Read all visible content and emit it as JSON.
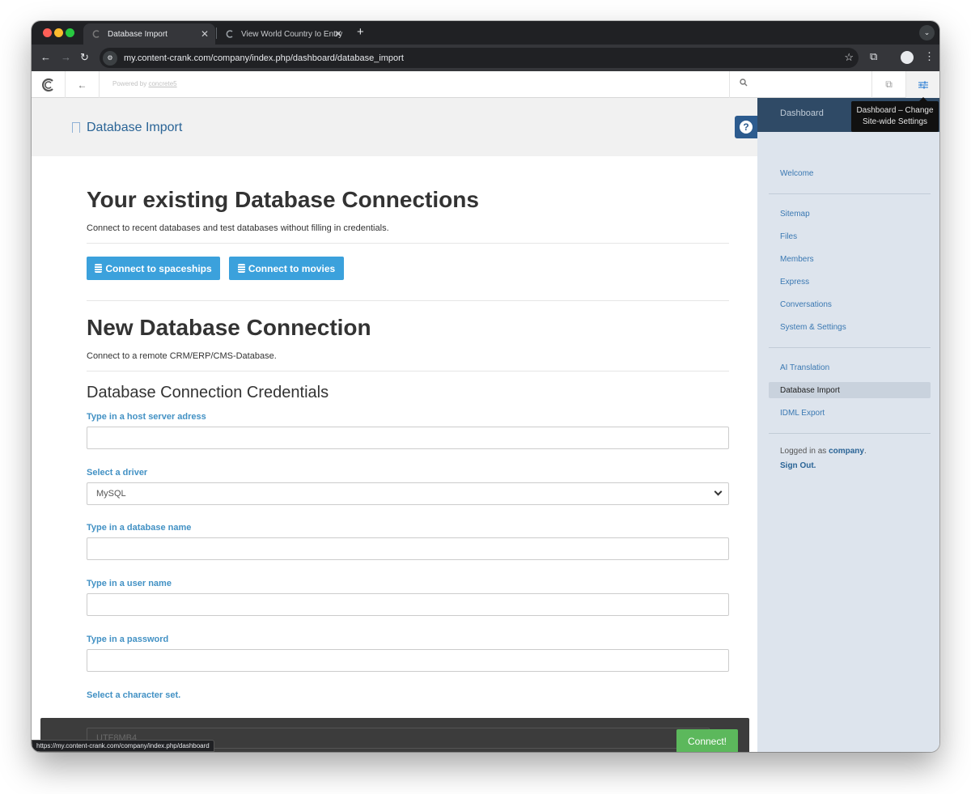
{
  "browser": {
    "tabs": [
      {
        "title": "Database Import",
        "active": true
      },
      {
        "title": "View World Country Io Entry",
        "active": false
      }
    ],
    "url": "my.content-crank.com/company/index.php/dashboard/database_import",
    "status_url": "https://my.content-crank.com/company/index.php/dashboard"
  },
  "toolbar": {
    "powered_prefix": "Powered by",
    "powered_link": "concrete5",
    "search_placeholder": ""
  },
  "tooltip": {
    "line1": "Dashboard – Change",
    "line2": "Site-wide Settings"
  },
  "page": {
    "title": "Database Import"
  },
  "existing": {
    "heading": "Your existing Database Connections",
    "description": "Connect to recent databases and test databases without filling in credentials.",
    "buttons": [
      {
        "label": "Connect to spaceships"
      },
      {
        "label": "Connect to movies"
      }
    ]
  },
  "new_connection": {
    "heading": "New Database Connection",
    "description": "Connect to a remote CRM/ERP/CMS-Database.",
    "credentials_heading": "Database Connection Credentials",
    "fields": {
      "host_label": "Type in a host server adress",
      "host_value": "",
      "driver_label": "Select a driver",
      "driver_value": "MySQL",
      "dbname_label": "Type in a database name",
      "dbname_value": "",
      "user_label": "Type in a user name",
      "user_value": "",
      "password_label": "Type in a password",
      "password_value": "",
      "charset_label": "Select a character set.",
      "charset_value": "UTF8MB4"
    },
    "connect_label": "Connect!"
  },
  "dashboard": {
    "header": "Dashboard",
    "group1": [
      "Welcome"
    ],
    "group2": [
      "Sitemap",
      "Files",
      "Members",
      "Express",
      "Conversations",
      "System & Settings"
    ],
    "group3": [
      "AI Translation",
      "Database Import",
      "IDML Export"
    ],
    "active_item": "Database Import",
    "logged_in_prefix": "Logged in as",
    "logged_in_user": "company",
    "logged_in_suffix": ".",
    "sign_out": "Sign Out."
  },
  "colors": {
    "primary_button": "#3ba1dc",
    "success_button": "#5cb85c",
    "label_blue": "#4291c4",
    "dash_panel": "#dde4ed"
  }
}
